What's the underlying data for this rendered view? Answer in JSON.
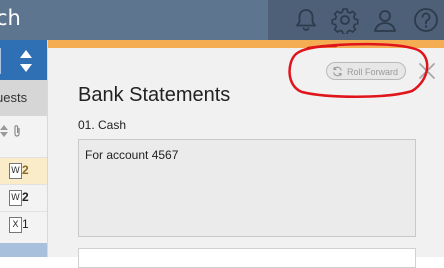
{
  "topbar": {
    "title": "ch",
    "icons": [
      "bell-icon",
      "gear-icon",
      "user-icon",
      "help-icon"
    ]
  },
  "sidebar": {
    "tab_label": "uests",
    "rows": [
      {
        "icon_letter": "W",
        "count": "2",
        "highlight": true
      },
      {
        "icon_letter": "W",
        "count": "2",
        "highlight": false
      },
      {
        "icon_letter": "X",
        "count": "1",
        "highlight": false
      }
    ]
  },
  "panel": {
    "title": "Bank Statements",
    "section": "01. Cash",
    "description": "For account 4567",
    "roll_forward_label": "Roll Forward",
    "accent_color": "#f5ad54"
  },
  "colors": {
    "topbar": "#5e7590",
    "topbar_right": "#4d6078",
    "sidebar_header": "#2f6fb3",
    "annotation": "#e0141b"
  }
}
